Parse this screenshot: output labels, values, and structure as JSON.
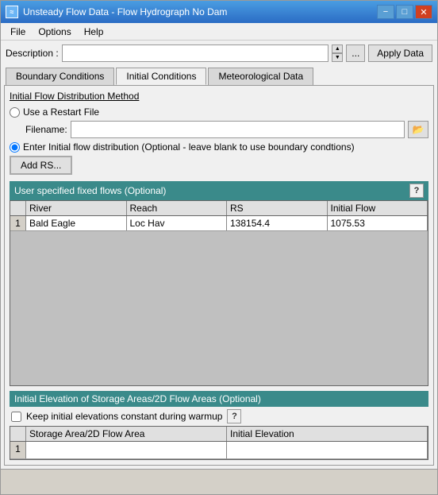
{
  "window": {
    "title": "Unsteady Flow Data - Flow Hydrograph No Dam",
    "icon": "≈"
  },
  "menu": {
    "items": [
      "File",
      "Options",
      "Help"
    ]
  },
  "description": {
    "label": "Description :",
    "value": "",
    "placeholder": ""
  },
  "buttons": {
    "apply_data": "Apply Data",
    "dots": "...",
    "add_rs": "Add RS...",
    "filename_browse": "📂"
  },
  "tabs": [
    {
      "label": "Boundary Conditions",
      "active": false
    },
    {
      "label": "Initial Conditions",
      "active": true
    },
    {
      "label": "Meteorological Data",
      "active": false
    }
  ],
  "initial_flow": {
    "section_title": "Initial Flow Distribution Method",
    "radio_options": [
      {
        "id": "restart",
        "label": "Use a Restart File",
        "checked": false
      },
      {
        "id": "enter",
        "label": "Enter Initial flow distribution (Optional - leave blank to use boundary condtions)",
        "checked": true
      }
    ],
    "filename_label": "Filename:"
  },
  "user_fixed_flows": {
    "header": "User specified fixed flows (Optional)",
    "columns": [
      "",
      "River",
      "Reach",
      "RS",
      "Initial Flow"
    ],
    "rows": [
      {
        "num": "1",
        "river": "Bald Eagle",
        "reach": "Loc Hav",
        "rs": "138154.4",
        "flow": "1075.53"
      }
    ]
  },
  "storage_section": {
    "header": "Initial Elevation of Storage Areas/2D Flow Areas (Optional)",
    "warmup_label": "Keep initial elevations constant during warmup",
    "warmup_checked": false,
    "columns": [
      "",
      "Storage Area/2D Flow Area",
      "Initial Elevation"
    ],
    "rows": [
      {
        "num": "1",
        "area": "",
        "elevation": ""
      }
    ]
  }
}
